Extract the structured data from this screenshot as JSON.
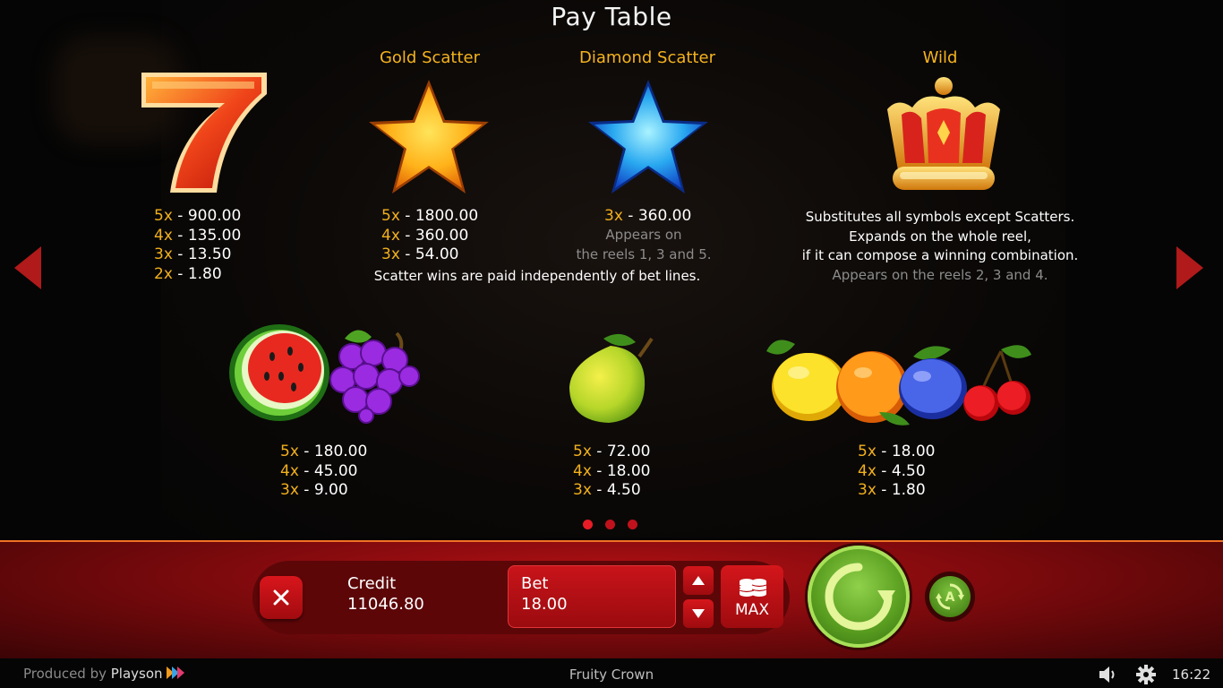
{
  "title": "Pay Table",
  "symbols": {
    "seven": {
      "icon": "seven-icon",
      "pays": [
        {
          "mult": "5x",
          "val": " - 900.00"
        },
        {
          "mult": "4x",
          "val": " - 135.00"
        },
        {
          "mult": "3x",
          "val": " - 13.50"
        },
        {
          "mult": "2x",
          "val": " - 1.80"
        }
      ]
    },
    "gold_scatter": {
      "label": "Gold Scatter",
      "icon": "gold-star-icon",
      "pays": [
        {
          "mult": "5x",
          "val": " - 1800.00"
        },
        {
          "mult": "4x",
          "val": " - 360.00"
        },
        {
          "mult": "3x",
          "val": " - 54.00"
        }
      ]
    },
    "diamond_scatter": {
      "label": "Diamond Scatter",
      "icon": "blue-star-icon",
      "pays": [
        {
          "mult": "3x",
          "val": " - 360.00"
        }
      ],
      "note_1": "Appears on",
      "note_2": "the reels 1, 3 and 5."
    },
    "scatter_note": "Scatter wins are paid independently of bet lines.",
    "wild": {
      "label": "Wild",
      "icon": "crown-icon",
      "desc_1": "Substitutes all symbols except Scatters.",
      "desc_2": "Expands on the whole reel,",
      "desc_3": "if it can compose a winning combination.",
      "desc_4": "Appears on the reels 2, 3 and 4."
    },
    "melon_grapes": {
      "icons": [
        "watermelon-icon",
        "grapes-icon"
      ],
      "pays": [
        {
          "mult": "5x",
          "val": " - 180.00"
        },
        {
          "mult": "4x",
          "val": " - 45.00"
        },
        {
          "mult": "3x",
          "val": " - 9.00"
        }
      ]
    },
    "pear": {
      "icon": "pear-icon",
      "pays": [
        {
          "mult": "5x",
          "val": " - 72.00"
        },
        {
          "mult": "4x",
          "val": " - 18.00"
        },
        {
          "mult": "3x",
          "val": " - 4.50"
        }
      ]
    },
    "small_fruits": {
      "icons": [
        "lemon-icon",
        "orange-icon",
        "plum-icon",
        "cherries-icon"
      ],
      "pays": [
        {
          "mult": "5x",
          "val": " - 18.00"
        },
        {
          "mult": "4x",
          "val": " - 4.50"
        },
        {
          "mult": "3x",
          "val": " - 1.80"
        }
      ]
    }
  },
  "pagination": {
    "pages": 3,
    "current": 1
  },
  "controls": {
    "credit_label": "Credit",
    "credit_value": "11046.80",
    "bet_label": "Bet",
    "bet_value": "18.00",
    "max_label": "MAX"
  },
  "footer": {
    "produced_prefix": "Produced by ",
    "brand": "Playson",
    "game_name": "Fruity Crown",
    "time": "16:22"
  },
  "colors": {
    "accent_gold": "#f2b01c",
    "bar_red": "#b51014",
    "spin_green": "#5a9e20",
    "arrow_red": "#b01a1a"
  }
}
